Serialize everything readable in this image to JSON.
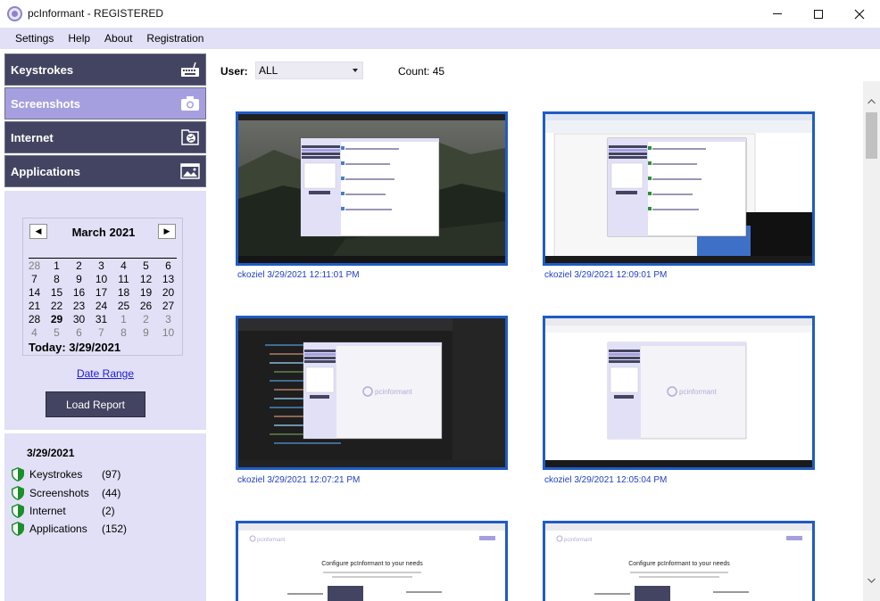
{
  "window": {
    "title": "pcInformant - REGISTERED"
  },
  "menu": [
    "Settings",
    "Help",
    "About",
    "Registration"
  ],
  "sidebar": {
    "nav": [
      {
        "label": "Keystrokes",
        "icon": "keyboard-icon"
      },
      {
        "label": "Screenshots",
        "icon": "camera-icon"
      },
      {
        "label": "Internet",
        "icon": "globe-icon"
      },
      {
        "label": "Applications",
        "icon": "image-icon"
      }
    ],
    "calendar": {
      "month_label": "March 2021",
      "prev_symbol": "◀",
      "next_symbol": "▶",
      "weeks": [
        [
          "28",
          "1",
          "2",
          "3",
          "4",
          "5",
          "6"
        ],
        [
          "7",
          "8",
          "9",
          "10",
          "11",
          "12",
          "13"
        ],
        [
          "14",
          "15",
          "16",
          "17",
          "18",
          "19",
          "20"
        ],
        [
          "21",
          "22",
          "23",
          "24",
          "25",
          "26",
          "27"
        ],
        [
          "28",
          "29",
          "30",
          "31",
          "1",
          "2",
          "3"
        ],
        [
          "4",
          "5",
          "6",
          "7",
          "8",
          "9",
          "10"
        ]
      ],
      "today_label": "Today: 3/29/2021",
      "selected_day": "29"
    },
    "date_range_link": "Date Range",
    "load_report_button": "Load Report",
    "summary": {
      "date": "3/29/2021",
      "items": [
        {
          "label": "Keystrokes",
          "count": "(97)"
        },
        {
          "label": "Screenshots",
          "count": "(44)"
        },
        {
          "label": "Internet",
          "count": "(2)"
        },
        {
          "label": "Applications",
          "count": "(152)"
        }
      ]
    }
  },
  "main": {
    "user_label": "User:",
    "user_value": "ALL",
    "count_label": "Count: 45",
    "thumb_text": {
      "logo": "pcinformant",
      "configure": "Configure pcInformant to your needs"
    },
    "screenshots": [
      {
        "caption": "ckoziel  3/29/2021 12:11:01 PM",
        "style": "landscape"
      },
      {
        "caption": "ckoziel  3/29/2021 12:09:01 PM",
        "style": "document"
      },
      {
        "caption": "ckoziel  3/29/2021 12:07:21 PM",
        "style": "editor"
      },
      {
        "caption": "ckoziel  3/29/2021 12:05:04 PM",
        "style": "web"
      },
      {
        "caption": "",
        "style": "configure"
      },
      {
        "caption": "",
        "style": "configure"
      }
    ]
  },
  "colors": {
    "nav_dark": "#434461",
    "nav_active": "#a69fdf",
    "panel_bg": "#e2e0f6",
    "thumb_border": "#1f5cc3",
    "caption": "#1e3fc4",
    "link": "#1b1bd6",
    "shield_green": "#1a8f2a"
  }
}
